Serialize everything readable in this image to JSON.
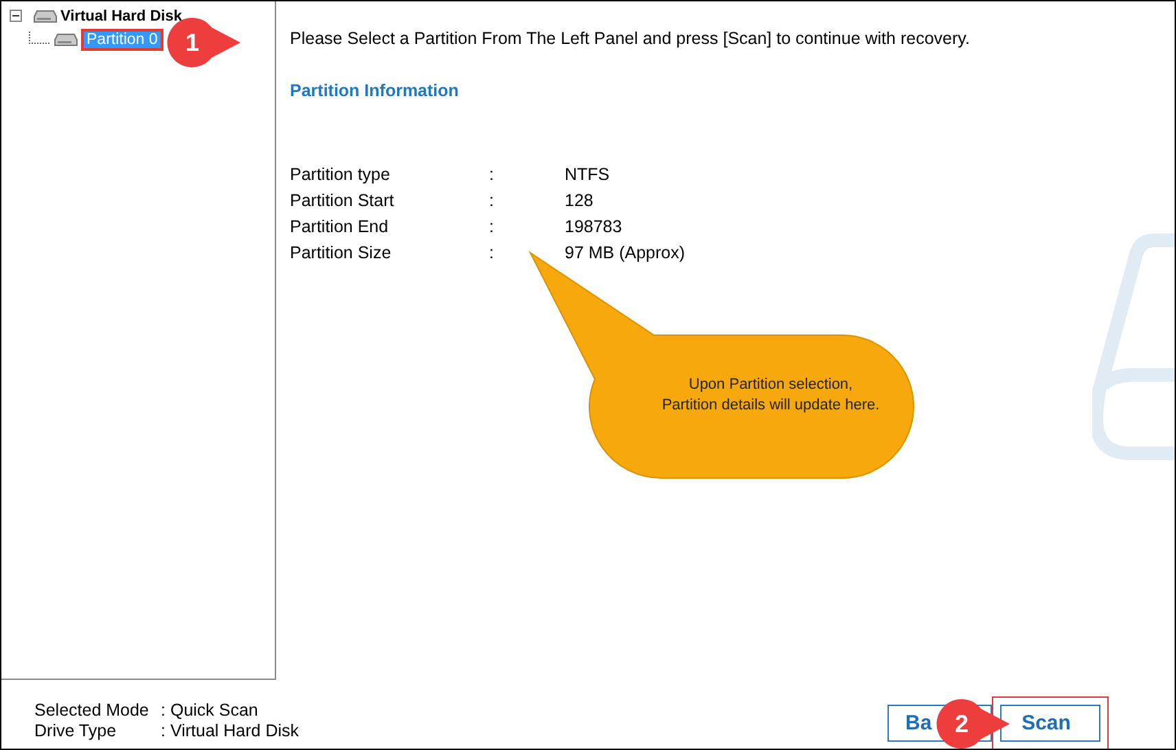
{
  "tree": {
    "label": "Virtual Hard Disk",
    "expanded": true,
    "children": [
      {
        "label": "Partition 0",
        "selected": true,
        "highlighted": true
      }
    ]
  },
  "step_badges": [
    {
      "number": "1"
    },
    {
      "number": "2"
    }
  ],
  "instruction": "Please Select a Partition From The Left Panel and press [Scan] to continue with recovery.",
  "section_title": "Partition Information",
  "partition_info": [
    {
      "label": "Partition type",
      "colon": ":",
      "value": "NTFS"
    },
    {
      "label": "Partition Start",
      "colon": ":",
      "value": "128"
    },
    {
      "label": "Partition End",
      "colon": ":",
      "value": "198783"
    },
    {
      "label": "Partition Size",
      "colon": ":",
      "value": "97 MB (Approx)"
    }
  ],
  "tooltip": "Upon Partition selection, Partition details will update here.",
  "status": [
    {
      "label": "Selected Mode",
      "colon": ":",
      "value": "Quick Scan"
    },
    {
      "label": "Drive Type",
      "colon": ":",
      "value": "Virtual Hard Disk"
    }
  ],
  "buttons": [
    {
      "label": "Ba",
      "highlighted": false
    },
    {
      "label": "Scan",
      "highlighted": true
    }
  ]
}
